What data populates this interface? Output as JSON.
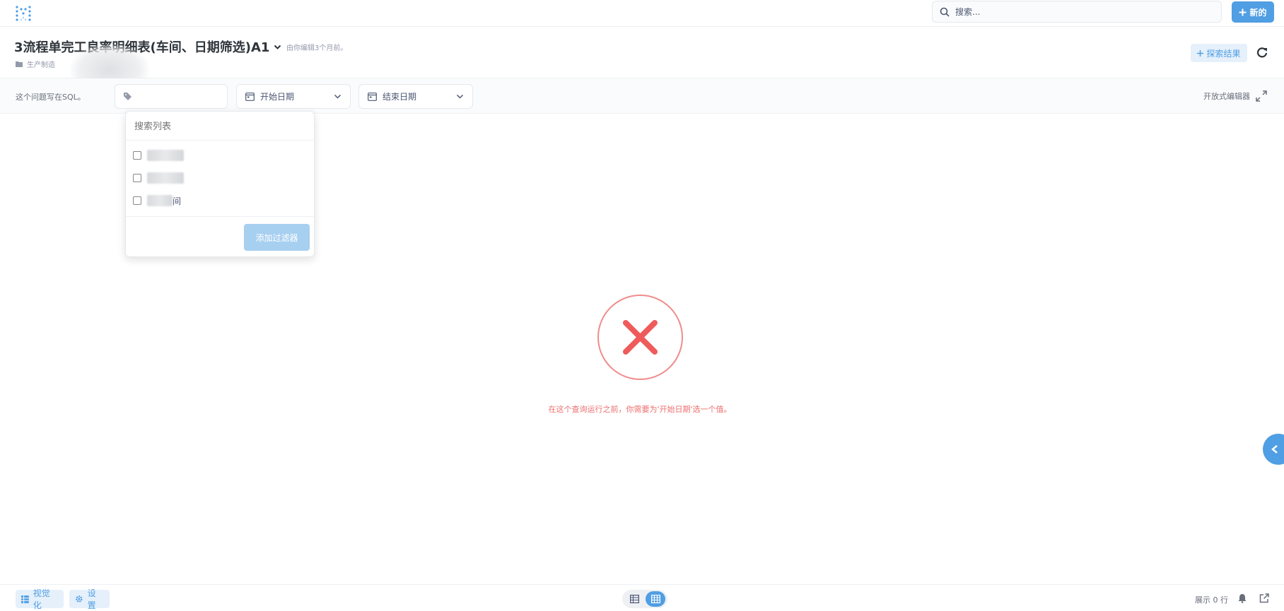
{
  "topbar": {
    "search_placeholder": "搜索...",
    "new_label": "新的"
  },
  "header": {
    "title": "3流程单完工良率明细表(车间、日期筛选)A1",
    "edited": "由你编辑3个月前。",
    "collection": "生产制造",
    "explore_label": "探索结果"
  },
  "filters": {
    "sql_note": "这个问题写在SQL。",
    "start_date": "开始日期",
    "end_date": "结束日期",
    "open_editor": "开放式编辑器"
  },
  "popover": {
    "search_placeholder": "搜索列表",
    "options": [
      {
        "label": ""
      },
      {
        "label": ""
      },
      {
        "label": "间"
      }
    ],
    "add_filter": "添加过滤器"
  },
  "error": {
    "message": "在这个查询运行之前，你需要为'开始日期'选一个值。"
  },
  "footer": {
    "visualize": "视觉化",
    "settings": "设置",
    "row_count": "展示 0 行"
  },
  "colors": {
    "brand": "#509ee3",
    "error": "#ed6e6e",
    "title": "#2e353b"
  },
  "icons": {
    "logo": "metabase-logo-icon",
    "search": "search-icon",
    "plus": "plus-icon",
    "refresh": "refresh-icon",
    "calendar": "calendar-icon",
    "chevron": "chevron-down-icon",
    "expand": "expand-icon",
    "close": "close-x-icon",
    "bell": "bell-icon",
    "share": "share-icon"
  }
}
